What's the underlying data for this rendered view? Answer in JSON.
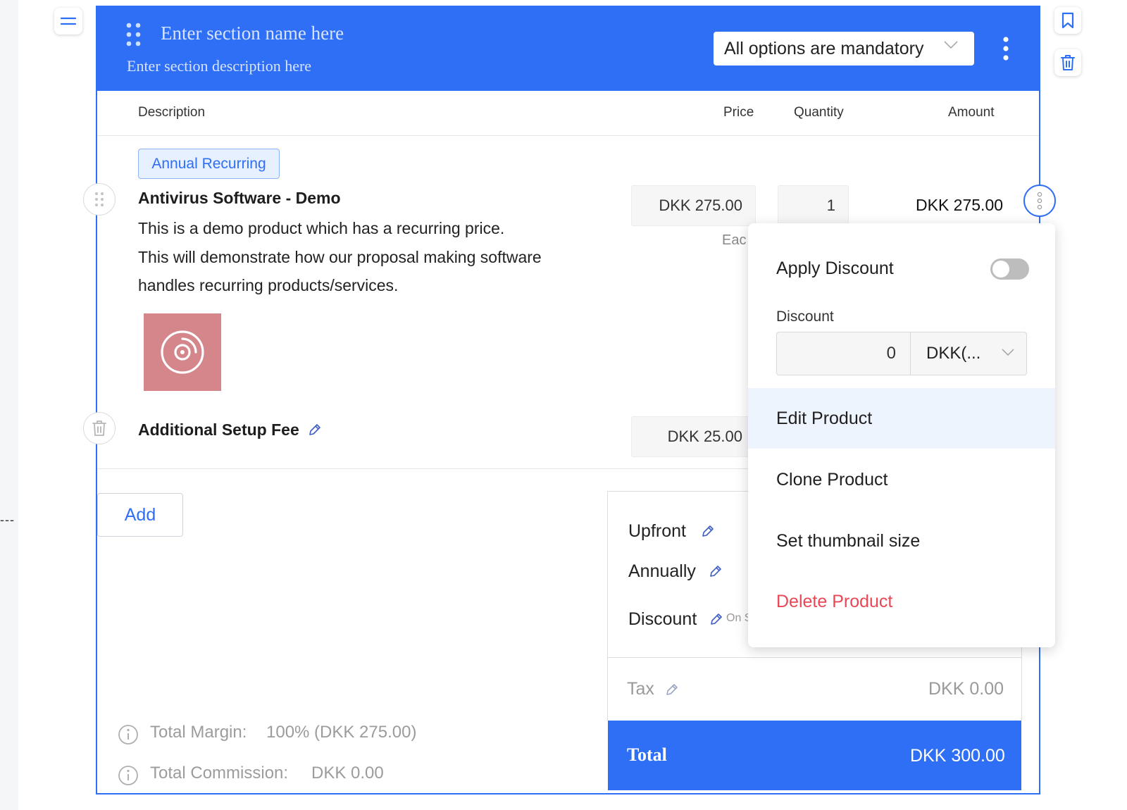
{
  "page": {
    "accent_color": "#2f6ff6",
    "danger_color": "#e84855"
  },
  "left_marker": "---",
  "section": {
    "name_placeholder": "Enter section name here",
    "description_placeholder": "Enter section description here",
    "options_select": "All options are mandatory"
  },
  "table": {
    "headers": {
      "description": "Description",
      "price": "Price",
      "quantity": "Quantity",
      "amount": "Amount"
    }
  },
  "products": [
    {
      "badge": "Annual Recurring",
      "title": "Antivirus Software - Demo",
      "description_lines": [
        "This is a demo product which has a recurring price.",
        "This will demonstrate how our proposal making software",
        "handles recurring products/services."
      ],
      "thumbnail_icon": "disc-icon",
      "price": "DKK 275.00",
      "price_unit": "Eac",
      "quantity": "1",
      "amount": "DKK 275.00"
    },
    {
      "title": "Additional Setup Fee",
      "price": "DKK 25.00"
    }
  ],
  "add_button": "Add",
  "summary": {
    "upfront": "Upfront",
    "annually": "Annually",
    "discount": "Discount",
    "discount_note": "On S",
    "tax_label": "Tax",
    "tax_value": "DKK 0.00",
    "total_label": "Total",
    "total_value": "DKK 300.00"
  },
  "margin": {
    "margin_label": "Total Margin:",
    "margin_value": "100% (DKK 275.00)",
    "commission_label": "Total Commission:",
    "commission_value": "DKK 0.00"
  },
  "context_menu": {
    "apply_discount": "Apply Discount",
    "apply_discount_on": false,
    "discount_label": "Discount",
    "discount_value": "0",
    "discount_currency": "DKK(...",
    "items": [
      "Edit Product",
      "Clone Product",
      "Set thumbnail size",
      "Delete Product"
    ]
  }
}
